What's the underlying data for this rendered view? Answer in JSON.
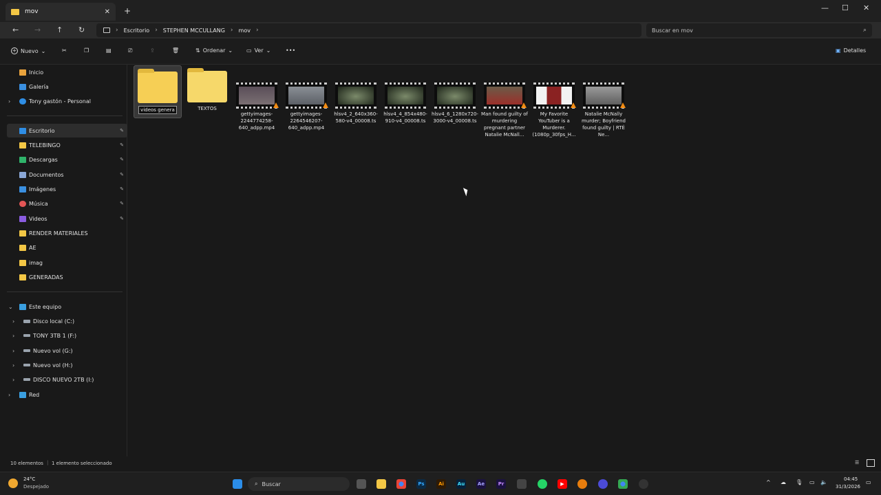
{
  "window": {
    "tab_title": "mov",
    "close_tab": "✕",
    "new_tab": "+",
    "minimize": "—",
    "maximize": "☐",
    "close": "✕"
  },
  "address": {
    "back": "←",
    "forward": "→",
    "up": "↑",
    "refresh": "↻",
    "breadcrumb": [
      "Escritorio",
      "STEPHEN MCCULLANG",
      "mov"
    ],
    "search_placeholder": "Buscar en mov"
  },
  "toolbar": {
    "new_label": "Nuevo",
    "sort_label": "Ordenar",
    "view_label": "Ver",
    "more_label": "•••",
    "details_label": "Detalles"
  },
  "sidebar": {
    "top_items": [
      {
        "label": "Inicio",
        "icon": "home-icon",
        "color": "#e8a23c"
      },
      {
        "label": "Galería",
        "icon": "gallery-icon",
        "color": "#3a8fe0"
      },
      {
        "label": "Tony gastón - Personal",
        "icon": "cloud-icon",
        "color": "#2f8ee5"
      }
    ],
    "pinned": [
      {
        "label": "Escritorio",
        "icon": "desktop-icon",
        "color": "#2f8ee5"
      },
      {
        "label": "TELEBINGO",
        "icon": "folder-icon",
        "color": "#f3c745"
      },
      {
        "label": "Descargas",
        "icon": "download-icon",
        "color": "#2fb36a"
      },
      {
        "label": "Documentos",
        "icon": "document-icon",
        "color": "#8aa7d6"
      },
      {
        "label": "Imágenes",
        "icon": "pictures-icon",
        "color": "#3a8fe0"
      },
      {
        "label": "Música",
        "icon": "music-icon",
        "color": "#e25555"
      },
      {
        "label": "Videos",
        "icon": "videos-icon",
        "color": "#8a5ce0"
      },
      {
        "label": "RENDER MATERIALES",
        "icon": "folder-icon",
        "color": "#f3c745"
      },
      {
        "label": "AE",
        "icon": "folder-icon",
        "color": "#f3c745"
      },
      {
        "label": "imag",
        "icon": "folder-icon",
        "color": "#f3c745"
      },
      {
        "label": "GENERADAS",
        "icon": "folder-icon",
        "color": "#f3c745"
      }
    ],
    "this_pc": "Este equipo",
    "drives": [
      "Disco local (C:)",
      "TONY 3TB 1 (F:)",
      "Nuevo vol (G:)",
      "Nuevo vol (H:)",
      "DISCO NUEVO 2TB (I:)"
    ],
    "network": "Red"
  },
  "files": [
    {
      "name": "videos genera",
      "type": "folder",
      "renaming": true
    },
    {
      "name": "TEXTOS",
      "type": "folder"
    },
    {
      "name": "gettyimages-2244774258-640_adpp.mp4",
      "type": "video",
      "tint": "#6e5a63"
    },
    {
      "name": "gettyimages-2264546207-640_adpp.mp4",
      "type": "video",
      "tint": "#7a7f86"
    },
    {
      "name": "hlsv4_2_640x360-580-v4_00008.ts",
      "type": "video",
      "tint": "#3a4434"
    },
    {
      "name": "hlsv4_4_854x480-910-v4_00008.ts",
      "type": "video",
      "tint": "#3a4434"
    },
    {
      "name": "hlsv4_6_1280x720-3000-v4_00008.ts",
      "type": "video",
      "tint": "#3a4434"
    },
    {
      "name": "Man found guilty of murdering pregnant partner Natalie McNall...",
      "type": "video",
      "tint": "#6b5b48"
    },
    {
      "name": "My Favorite YouTuber is a Murderer. (1080p_30fps_H...",
      "type": "video",
      "tint": "#8a2222"
    },
    {
      "name": "Natalie McNally murder; Boyfriend found guilty | RTÉ Ne...",
      "type": "video",
      "tint": "#7f7f7f"
    }
  ],
  "status": {
    "count": "10 elementos",
    "selected": "1 elemento seleccionado"
  },
  "taskbar": {
    "temp": "24°C",
    "weather": "Despejado",
    "search": "Buscar",
    "time": "04:45",
    "date": "31/3/2026"
  }
}
